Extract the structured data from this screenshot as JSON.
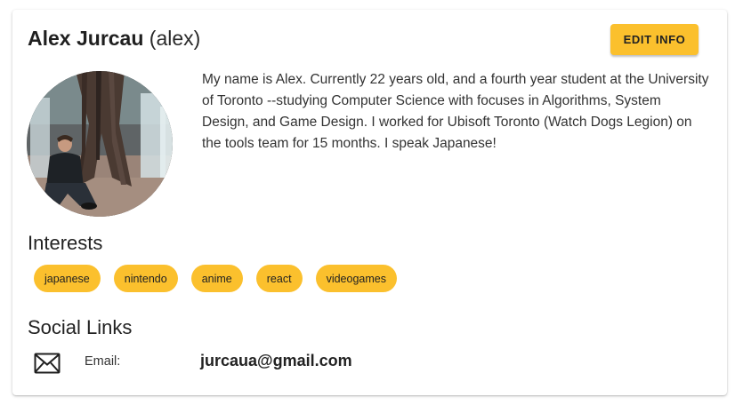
{
  "profile": {
    "full_name": "Alex Jurcau",
    "username": "(alex)",
    "edit_button_label": "EDIT INFO",
    "bio": "My name is Alex. Currently 22 years old, and a fourth year student at the University of Toronto --studying Computer Science with focuses in Algorithms, System Design, and Game Design. I worked for Ubisoft Toronto (Watch Dogs Legion) on the tools team for 15 months. I speak Japanese!"
  },
  "interests": {
    "title": "Interests",
    "items": [
      "japanese",
      "nintendo",
      "anime",
      "react",
      "videogames"
    ]
  },
  "social": {
    "title": "Social Links",
    "email_label": "Email:",
    "email_value": "jurcaua@gmail.com",
    "email_icon": "mail-icon"
  },
  "colors": {
    "accent": "#fbc02d",
    "text": "#222222",
    "card_background": "#ffffff"
  }
}
